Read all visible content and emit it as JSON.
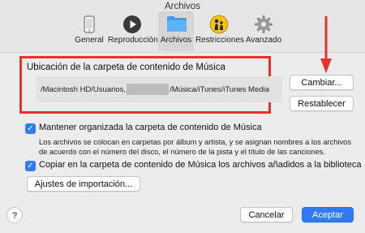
{
  "window": {
    "title": "Archivos"
  },
  "toolbar": {
    "items": [
      {
        "label": "General",
        "icon": "phone-icon"
      },
      {
        "label": "Reproducción",
        "icon": "play-icon"
      },
      {
        "label": "Archivos",
        "icon": "folder-icon",
        "selected": true
      },
      {
        "label": "Restricciones",
        "icon": "parental-icon"
      },
      {
        "label": "Avanzado",
        "icon": "gear-icon"
      }
    ]
  },
  "location": {
    "title": "Ubicación de la carpeta de contenido de Música",
    "path_prefix": "/Macintosh HD/Usuarios,",
    "path_suffix": "/Música/iTunes/iTunes Media"
  },
  "buttons": {
    "change": "Cambiar...",
    "reset": "Restablecer",
    "import_settings": "Ajustes de importación...",
    "cancel": "Cancelar",
    "accept": "Aceptar",
    "help": "?"
  },
  "options": {
    "keep_organized": {
      "label": "Mantener organizada la carpeta de contenido de Música",
      "checked": true,
      "desc1": "Los archivos se colocan en carpetas por álbum y artista, y se asignan nombres a los archivos",
      "desc2": "de acuerdo con el número del disco, el número de la pista y el título de las canciones."
    },
    "copy_files": {
      "label": "Copiar en la carpeta de contenido de Música los archivos añadidos a la biblioteca",
      "checked": true
    }
  },
  "colors": {
    "accent": "#2f7cf6",
    "highlight": "#e5322b"
  }
}
